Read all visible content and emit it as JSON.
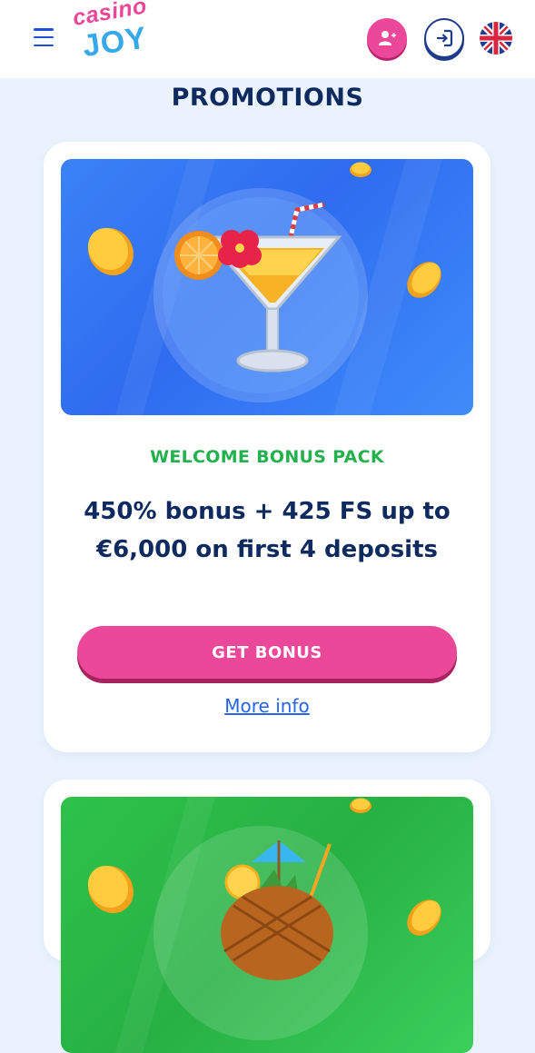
{
  "header": {
    "logo_line1": "casino",
    "logo_line2": "JOY",
    "menu_icon": "hamburger-menu-icon",
    "register_icon": "add-user-icon",
    "login_icon": "login-icon",
    "language_icon": "uk-flag-icon"
  },
  "page": {
    "title": "PROMOTIONS"
  },
  "promotions": [
    {
      "image": "cocktail-glass-with-orange-and-flower",
      "tag": "WELCOME BONUS PACK",
      "description": "450% bonus + 425 FS up to €6,000 on first 4 deposits",
      "cta_label": "GET BONUS",
      "more_info_label": "More info"
    },
    {
      "image": "pineapple-cocktail-with-umbrella"
    }
  ],
  "colors": {
    "accent_pink": "#ec4899",
    "navy": "#0f2a5f",
    "tag_green": "#22b14c",
    "link_blue": "#2563eb",
    "page_bg": "#eaf3fd"
  }
}
